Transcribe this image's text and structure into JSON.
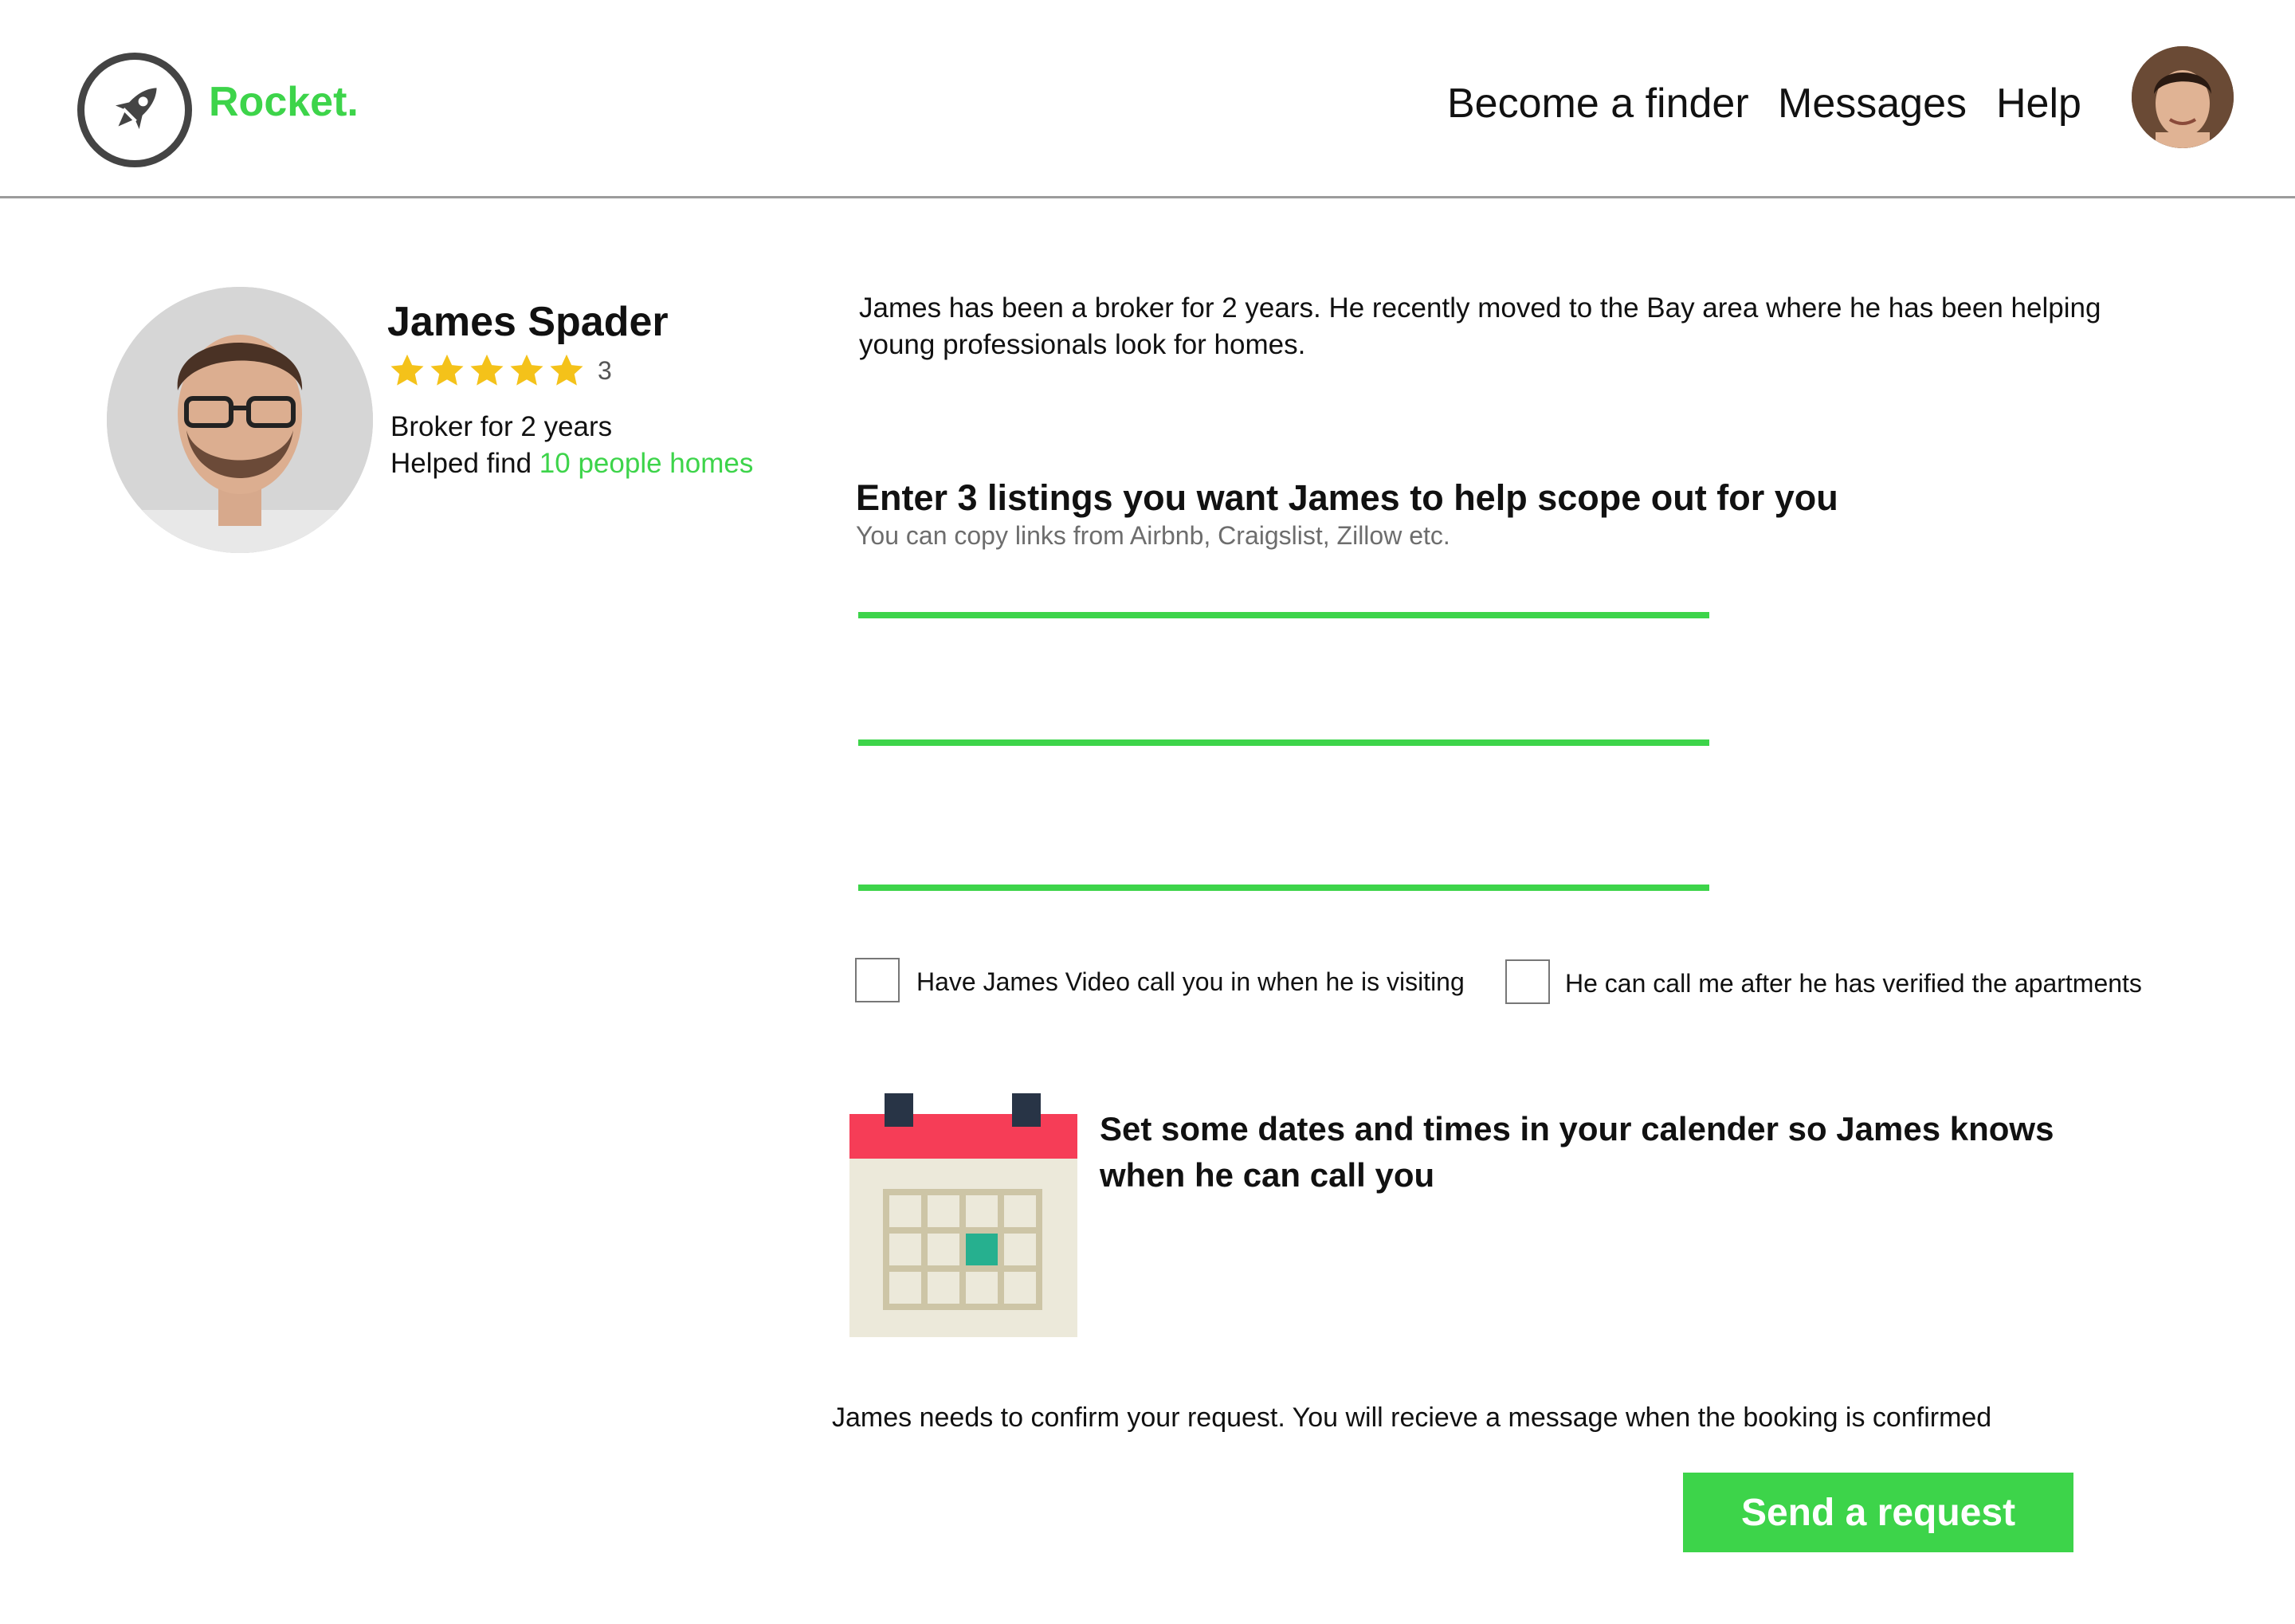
{
  "brand": {
    "name": "Rocket.",
    "logo_icon": "rocket-icon",
    "accent_color": "#3dd44a"
  },
  "nav": {
    "links": [
      "Become a finder",
      "Messages",
      "Help"
    ],
    "avatar_icon": "user-avatar"
  },
  "profile": {
    "name": "James Spader",
    "rating": 5,
    "rating_count": "3",
    "experience": "Broker for 2 years",
    "helped_prefix": "Helped find ",
    "helped_link": "10 people homes"
  },
  "bio": "James has been a broker for 2 years. He recently moved to the Bay area where he has been helping young professionals look for homes.",
  "listings": {
    "title": "Enter 3 listings you want James to help scope out for you",
    "subtitle": "You can copy links from Airbnb, Craigslist, Zillow etc.",
    "inputs": [
      "",
      "",
      ""
    ]
  },
  "options": [
    {
      "label": "Have James Video call you in when he is visiting",
      "checked": false
    },
    {
      "label": "He can call me after he has verified the apartments",
      "checked": false
    }
  ],
  "calendar": {
    "icon": "calendar-icon",
    "text": "Set some dates and times in your calender so James knows when he can call you"
  },
  "confirm_note": "James needs to confirm your request. You will recieve a message when the booking is confirmed",
  "send_button": "Send a request"
}
